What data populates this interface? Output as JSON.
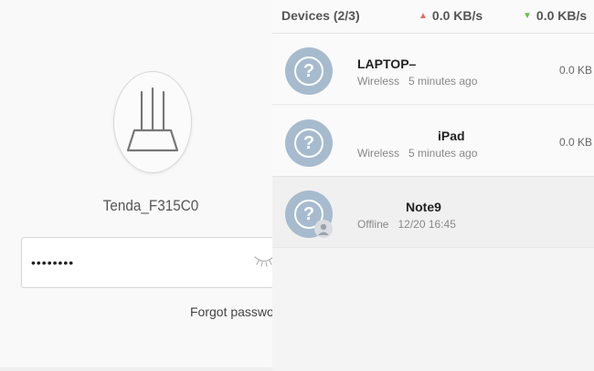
{
  "login": {
    "router_name": "Tenda_F315C0",
    "password_value": "••••••••",
    "forgot_label": "Forgot passwor"
  },
  "devices": {
    "title": "Devices (2/3)",
    "upload_rate": "0.0  KB/s",
    "download_rate": "0.0  KB/s",
    "list": [
      {
        "name": "LAPTOP–",
        "connection": "Wireless",
        "time": "5 minutes ago",
        "rate": "0.0  KB"
      },
      {
        "name": "iPad",
        "connection": "Wireless",
        "time": "5 minutes ago",
        "rate": "0.0  KB"
      },
      {
        "name": "Note9",
        "connection": "Offline",
        "time": "12/20 16:45"
      }
    ]
  },
  "colors": {
    "avatar": "#a7bbce",
    "upload_arrow": "#e07060",
    "download_arrow": "#6cbd4c"
  },
  "icons": {
    "router": "router-icon",
    "password_visibility": "eye-closed-icon",
    "device": "question-mark-icon",
    "offline_badge": "user-icon"
  }
}
